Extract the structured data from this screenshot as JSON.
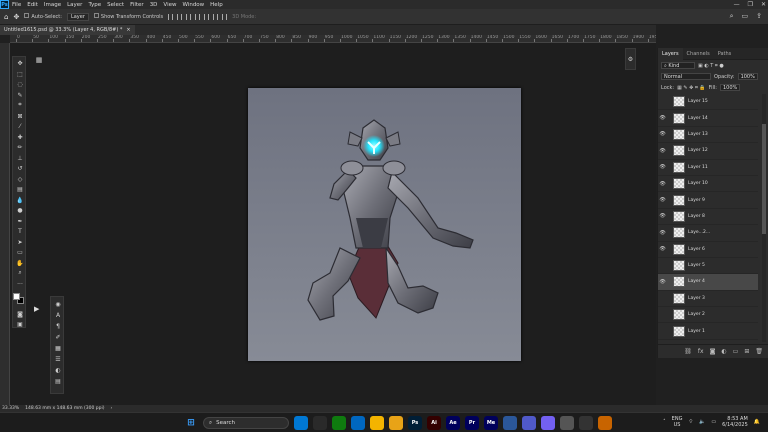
{
  "app": {
    "logo": "Ps"
  },
  "menu": [
    "File",
    "Edit",
    "Image",
    "Layer",
    "Type",
    "Select",
    "Filter",
    "3D",
    "View",
    "Window",
    "Help"
  ],
  "window_controls": [
    "—",
    "❐",
    "✕"
  ],
  "options_bar": {
    "auto_select_label": "Auto-Select:",
    "auto_select_value": "Layer",
    "transform_label": "Show Transform Controls",
    "mode_3d_label": "3D Mode:"
  },
  "document": {
    "tab_title": "Untitled1615.psd @ 33.3% (Layer 4, RGB/8#) *",
    "close": "×"
  },
  "ruler_ticks": [
    "0",
    "50",
    "100",
    "150",
    "200",
    "250",
    "300",
    "350",
    "400",
    "450",
    "500",
    "550",
    "600",
    "650",
    "700",
    "750",
    "800",
    "850",
    "900",
    "950",
    "1000",
    "1050",
    "1100",
    "1150",
    "1200",
    "1250",
    "1300",
    "1350",
    "1400",
    "1450",
    "1500",
    "1550",
    "1600",
    "1650",
    "1700",
    "1750",
    "1800",
    "1850",
    "1900",
    "1950",
    "2000"
  ],
  "layers_panel": {
    "tabs": [
      "Layers",
      "Channels",
      "Paths"
    ],
    "kind_label": "Kind",
    "blend_mode": "Normal",
    "opacity_label": "Opacity:",
    "opacity_value": "100%",
    "lock_label": "Lock:",
    "fill_label": "Fill:",
    "fill_value": "100%",
    "layers": [
      {
        "name": "Layer 15",
        "visible": false,
        "selected": false
      },
      {
        "name": "Layer 14",
        "visible": true,
        "selected": false
      },
      {
        "name": "Layer 13",
        "visible": true,
        "selected": false
      },
      {
        "name": "Layer 12",
        "visible": true,
        "selected": false
      },
      {
        "name": "Layer 11",
        "visible": true,
        "selected": false
      },
      {
        "name": "Layer 10",
        "visible": true,
        "selected": false
      },
      {
        "name": "Layer 9",
        "visible": true,
        "selected": false
      },
      {
        "name": "Layer 8",
        "visible": true,
        "selected": false
      },
      {
        "name": "Laye...2...",
        "visible": true,
        "selected": false
      },
      {
        "name": "Layer 6",
        "visible": true,
        "selected": false
      },
      {
        "name": "Layer 5",
        "visible": false,
        "selected": false
      },
      {
        "name": "Layer 4",
        "visible": true,
        "selected": true
      },
      {
        "name": "Layer 3",
        "visible": false,
        "selected": false
      },
      {
        "name": "Layer 2",
        "visible": false,
        "selected": false
      },
      {
        "name": "Layer 1",
        "visible": false,
        "selected": false
      }
    ]
  },
  "status": {
    "zoom": "33.33%",
    "doc_size": "148.63 mm x 148.63 mm (300 ppi)"
  },
  "taskbar": {
    "search_placeholder": "Search",
    "apps": [
      {
        "label": "",
        "color": "#0078d4"
      },
      {
        "label": "",
        "color": "#2a2a2a"
      },
      {
        "label": "",
        "color": "#0f7b0f"
      },
      {
        "label": "",
        "color": "#0067c0"
      },
      {
        "label": "",
        "color": "#f4b400"
      },
      {
        "label": "",
        "color": "#e8a317"
      },
      {
        "label": "Ps",
        "color": "#001e36"
      },
      {
        "label": "Ai",
        "color": "#330000"
      },
      {
        "label": "Ae",
        "color": "#00005b"
      },
      {
        "label": "Pr",
        "color": "#00005b"
      },
      {
        "label": "Me",
        "color": "#00005b"
      },
      {
        "label": "",
        "color": "#2b579a"
      },
      {
        "label": "",
        "color": "#5059c9"
      },
      {
        "label": "",
        "color": "#7360f2"
      },
      {
        "label": "",
        "color": "#555"
      },
      {
        "label": "",
        "color": "#333"
      },
      {
        "label": "",
        "color": "#c86400"
      }
    ],
    "lang_top": "ENG",
    "lang_bottom": "US",
    "time": "8:53 AM",
    "date": "6/14/2025"
  }
}
